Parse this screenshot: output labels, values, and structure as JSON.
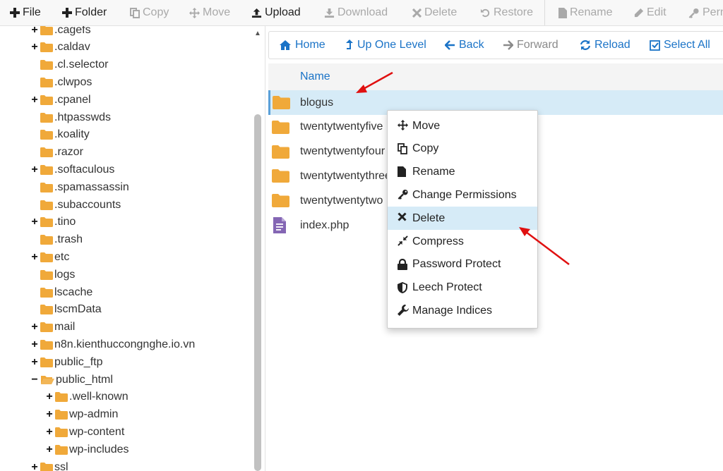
{
  "toolbar": {
    "file": "File",
    "folder": "Folder",
    "copy": "Copy",
    "move": "Move",
    "upload": "Upload",
    "download": "Download",
    "delete": "Delete",
    "restore": "Restore",
    "rename": "Rename",
    "edit": "Edit",
    "permissions": "Permi"
  },
  "tree": [
    {
      "label": ".cagefs",
      "toggle": "+"
    },
    {
      "label": ".caldav",
      "toggle": "+"
    },
    {
      "label": ".cl.selector",
      "toggle": ""
    },
    {
      "label": ".clwpos",
      "toggle": ""
    },
    {
      "label": ".cpanel",
      "toggle": "+"
    },
    {
      "label": ".htpasswds",
      "toggle": ""
    },
    {
      "label": ".koality",
      "toggle": ""
    },
    {
      "label": ".razor",
      "toggle": ""
    },
    {
      "label": ".softaculous",
      "toggle": "+"
    },
    {
      "label": ".spamassassin",
      "toggle": ""
    },
    {
      "label": ".subaccounts",
      "toggle": ""
    },
    {
      "label": ".tino",
      "toggle": "+"
    },
    {
      "label": ".trash",
      "toggle": ""
    },
    {
      "label": "etc",
      "toggle": "+"
    },
    {
      "label": "logs",
      "toggle": ""
    },
    {
      "label": "lscache",
      "toggle": ""
    },
    {
      "label": "lscmData",
      "toggle": ""
    },
    {
      "label": "mail",
      "toggle": "+"
    },
    {
      "label": "n8n.kienthuccongnghe.io.vn",
      "toggle": "+"
    },
    {
      "label": "public_ftp",
      "toggle": "+"
    },
    {
      "label": "public_html",
      "toggle": "−"
    },
    {
      "label": ".well-known",
      "toggle": "+"
    },
    {
      "label": "wp-admin",
      "toggle": "+"
    },
    {
      "label": "wp-content",
      "toggle": "+"
    },
    {
      "label": "wp-includes",
      "toggle": "+"
    },
    {
      "label": "ssl",
      "toggle": "+"
    }
  ],
  "nav": {
    "home": "Home",
    "up": "Up One Level",
    "back": "Back",
    "forward": "Forward",
    "reload": "Reload",
    "select_all": "Select All"
  },
  "table": {
    "column_name": "Name"
  },
  "files": [
    {
      "name": "blogus",
      "type": "folder"
    },
    {
      "name": "twentytwentyfive",
      "type": "folder"
    },
    {
      "name": "twentytwentyfour",
      "type": "folder"
    },
    {
      "name": "twentytwentythree",
      "type": "folder"
    },
    {
      "name": "twentytwentytwo",
      "type": "folder"
    },
    {
      "name": "index.php",
      "type": "file"
    }
  ],
  "context_menu": [
    {
      "label": "Move",
      "icon": "move-icon"
    },
    {
      "label": "Copy",
      "icon": "copy-icon"
    },
    {
      "label": "Rename",
      "icon": "file-icon"
    },
    {
      "label": "Change Permissions",
      "icon": "key-icon"
    },
    {
      "label": "Delete",
      "icon": "close-icon"
    },
    {
      "label": "Compress",
      "icon": "compress-icon"
    },
    {
      "label": "Password Protect",
      "icon": "lock-icon"
    },
    {
      "label": "Leech Protect",
      "icon": "shield-icon"
    },
    {
      "label": "Manage Indices",
      "icon": "wrench-icon"
    }
  ],
  "colors": {
    "folder": "#f0a93a",
    "link": "#1a73c7",
    "selected_row": "#d6ebf7",
    "annotation_arrow": "#e01010",
    "php_file": "#8466b4"
  }
}
